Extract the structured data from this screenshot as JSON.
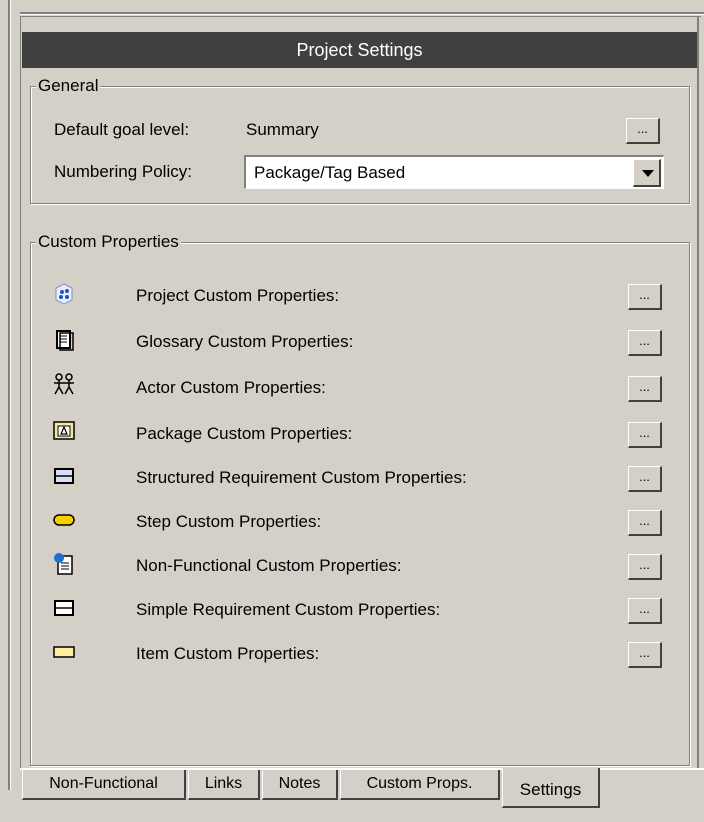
{
  "window": {
    "title": "Project Settings"
  },
  "general": {
    "legend": "General",
    "default_goal_level_label": "Default goal level:",
    "default_goal_level_value": "Summary",
    "ellipsis": "...",
    "numbering_policy_label": "Numbering Policy:",
    "numbering_policy_value": "Package/Tag Based"
  },
  "custom_properties": {
    "legend": "Custom Properties",
    "items": [
      {
        "label": "Project Custom Properties:",
        "icon": "project-icon"
      },
      {
        "label": "Glossary Custom Properties:",
        "icon": "glossary-icon"
      },
      {
        "label": "Actor Custom Properties:",
        "icon": "actor-icon"
      },
      {
        "label": "Package Custom Properties:",
        "icon": "package-icon"
      },
      {
        "label": "Structured Requirement Custom Properties:",
        "icon": "structured-requirement-icon"
      },
      {
        "label": "Step Custom Properties:",
        "icon": "step-icon"
      },
      {
        "label": "Non-Functional Custom Properties:",
        "icon": "non-functional-icon"
      },
      {
        "label": "Simple Requirement Custom Properties:",
        "icon": "simple-requirement-icon"
      },
      {
        "label": "Item Custom Properties:",
        "icon": "item-icon"
      }
    ],
    "ellipsis": "..."
  },
  "tabs": [
    {
      "label": "Non-Functional"
    },
    {
      "label": "Links"
    },
    {
      "label": "Notes"
    },
    {
      "label": "Custom Props."
    },
    {
      "label": "Settings",
      "active": true
    }
  ]
}
